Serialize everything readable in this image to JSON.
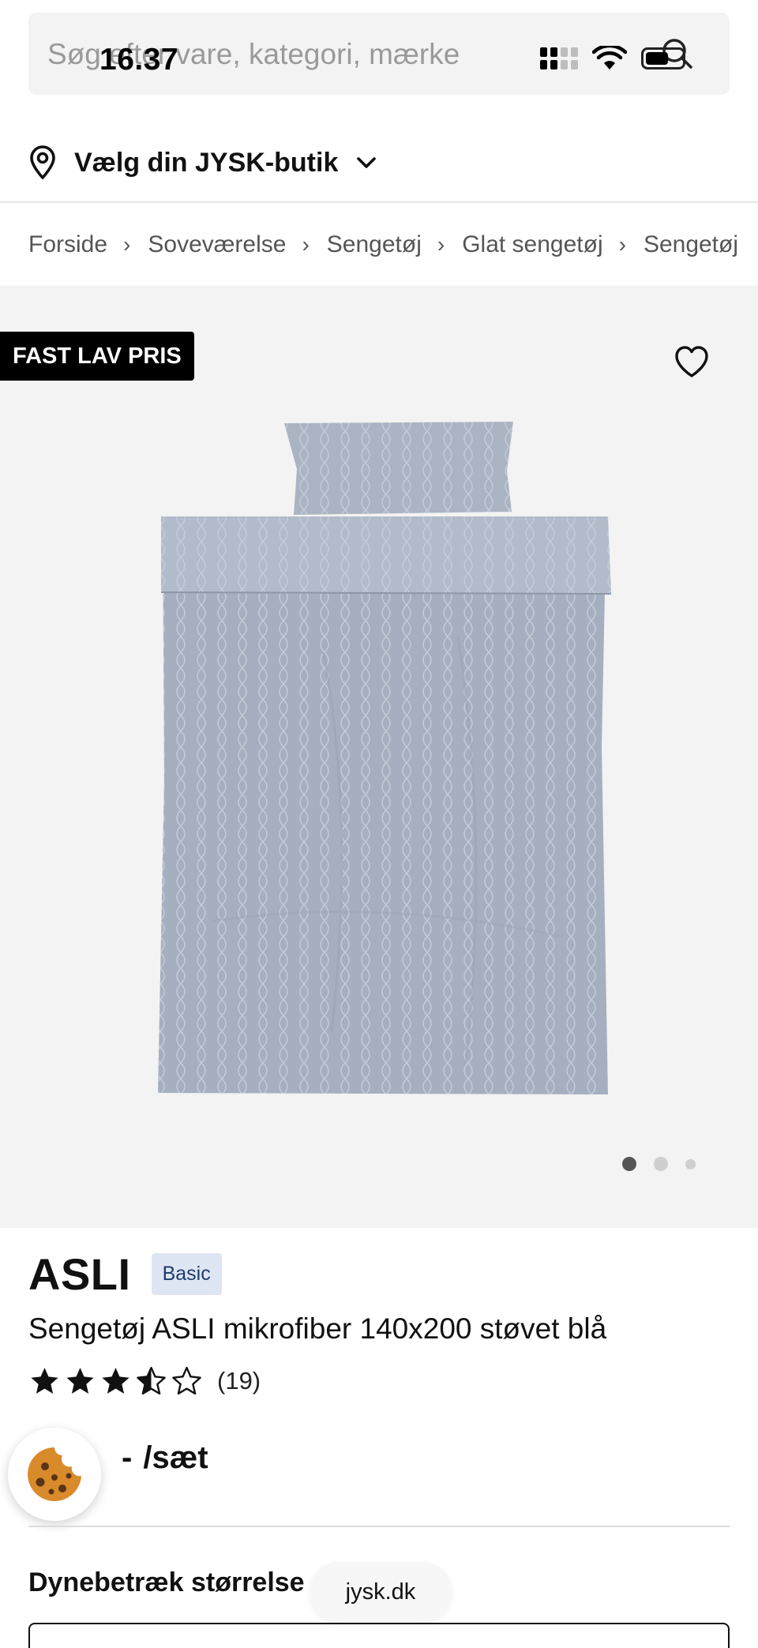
{
  "status_bar": {
    "time": "16.37"
  },
  "search": {
    "placeholder": "Søg efter vare, kategori, mærke"
  },
  "store": {
    "label": "Vælg din JYSK-butik"
  },
  "breadcrumb": [
    "Forside",
    "Soveværelse",
    "Sengetøj",
    "Glat sengetøj",
    "Sengetøj"
  ],
  "badge": {
    "label": "FAST LAV PRIS"
  },
  "gallery": {
    "active_index": 0,
    "total": 3
  },
  "product": {
    "brand": "ASLI",
    "tag": "Basic",
    "title": "Sengetøj ASLI mikrofiber 140x200 støvet blå",
    "rating": 3.5,
    "rating_max": 5,
    "review_count": "(19)",
    "price_value": "-",
    "price_unit": "/sæt"
  },
  "options": {
    "size_label": "Dynebetræk størrelse"
  },
  "browser": {
    "url": "jysk.dk"
  },
  "colors": {
    "badge_bg": "#000000",
    "tag_bg": "#dfe6f3",
    "tag_text": "#1f3b6e",
    "image_bg": "#f3f3f3",
    "bedding": "#a9b3c2",
    "cookie": "#d98a2b"
  },
  "icons": [
    "search-icon",
    "location-pin-icon",
    "chevron-down-icon",
    "chevron-right-icon",
    "heart-icon",
    "star-icon",
    "cookie-icon",
    "wifi-icon",
    "battery-icon",
    "cellular-signal-icon"
  ]
}
